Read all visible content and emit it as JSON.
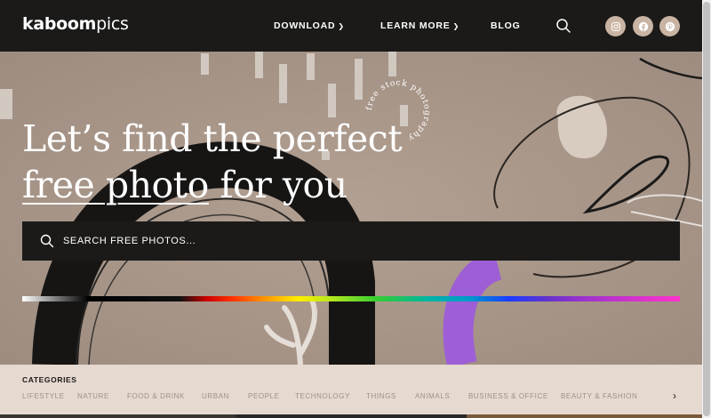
{
  "header": {
    "logo_bold": "kaboom",
    "logo_light": "pics",
    "nav": {
      "download": "DOWNLOAD",
      "learn_more": "LEARN MORE",
      "blog": "BLOG"
    },
    "social_icons": [
      "instagram-icon",
      "facebook-icon",
      "pinterest-icon"
    ]
  },
  "hero": {
    "title_line1": "Let’s find the perfect",
    "title_line2_underlined": "free photo",
    "title_line2_rest": " for you",
    "badge_text": "free stock photography",
    "search_placeholder": "SEARCH FREE PHOTOS..."
  },
  "categories": {
    "heading": "CATEGORIES",
    "items": [
      "LIFESTYLE",
      "NATURE",
      "FOOD & DRINK",
      "URBAN",
      "PEOPLE",
      "TECHNOLOGY",
      "THINGS",
      "ANIMALS",
      "BUSINESS & OFFICE",
      "BEAUTY & FASHION"
    ],
    "next_icon": "chevron-right-icon"
  },
  "colors": {
    "header_bg": "#1b1a19",
    "hero_bg": "#a8968a",
    "categories_bg": "#e6d9cf",
    "social_bg": "#c9b4a3"
  }
}
